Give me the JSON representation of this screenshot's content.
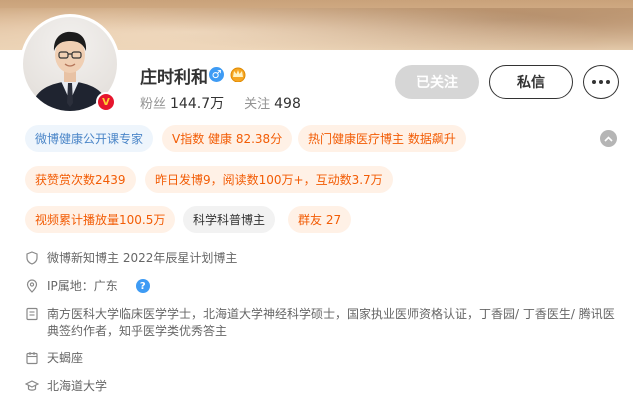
{
  "profile": {
    "name": "庄时利和",
    "gender_icon": "male-icon",
    "crown_icon": "crown-icon",
    "verified_badge": "V",
    "stats": {
      "fans_label": "粉丝",
      "fans_value": "144.7万",
      "following_label": "关注",
      "following_value": "498"
    }
  },
  "actions": {
    "follow_label": "已关注",
    "message_label": "私信",
    "more_icon": "more-icon"
  },
  "tags": {
    "row1": [
      "微博健康公开课专家",
      "V指数 健康 82.38分",
      "热门健康医疗博主 数据飙升"
    ],
    "row2": [
      "获赞赏次数2439",
      "昨日发博9，阅读数100万+，互动数3.7万"
    ],
    "row3": [
      "视频累计播放量100.5万",
      "科学科普博主",
      "群友 27"
    ]
  },
  "info": {
    "creator": "微博新知博主 2022年辰星计划博主",
    "ip": "IP属地：广东",
    "bio": [
      "南方医科大学临床医学学士，北海道大学神经科学硕士，国家执业医师资格认证，丁香园/ 丁香医生/ 腾讯医",
      "典签约作者，知乎医学类优秀答主"
    ],
    "zodiac": "天蝎座",
    "school": "北海道大学"
  },
  "colors": {
    "accent_orange": "#f25c05",
    "accent_blue": "#4b86c8",
    "verified_red": "#e6162d",
    "gender_blue": "#3e9bf4"
  }
}
